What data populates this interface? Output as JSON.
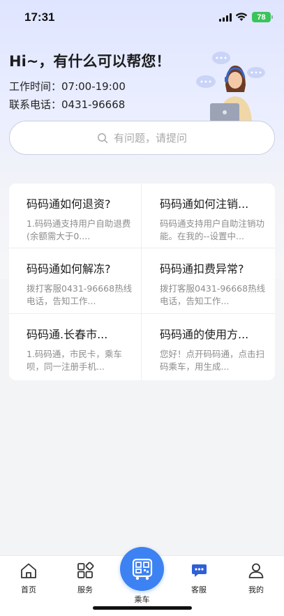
{
  "status_bar": {
    "time": "17:31",
    "battery": "78"
  },
  "header": {
    "greeting": "Hi~，有什么可以帮您！",
    "work_hours": "工作时间：07:00-19:00",
    "phone": "联系电话：0431-96668"
  },
  "search": {
    "placeholder": "有问题，请提问"
  },
  "faq": [
    {
      "title": "码码通如何退资?",
      "desc": "1.码码通支持用户自助退费 (余额需大于0...."
    },
    {
      "title": "码码通如何注销...",
      "desc": "码码通支持用户自助注销功能。在我的--设置中..."
    },
    {
      "title": "码码通如何解冻?",
      "desc": "拨打客服0431-96668热线电话，告知工作..."
    },
    {
      "title": "码码通扣费异常?",
      "desc": "拨打客服0431-96668热线电话，告知工作..."
    },
    {
      "title": "码码通.长春市...",
      "desc": "1.码码通，市民卡，乘车呗，同一注册手机..."
    },
    {
      "title": "码码通的使用方...",
      "desc": "您好！点开码码通，点击扫码乘车，用生成..."
    }
  ],
  "tabbar": {
    "home": "首页",
    "service": "服务",
    "ride": "乘车",
    "customer_service": "客服",
    "mine": "我的"
  },
  "colors": {
    "accent": "#3d82f2",
    "battery": "#39c45a",
    "active_tab": "#2f5fd6"
  }
}
